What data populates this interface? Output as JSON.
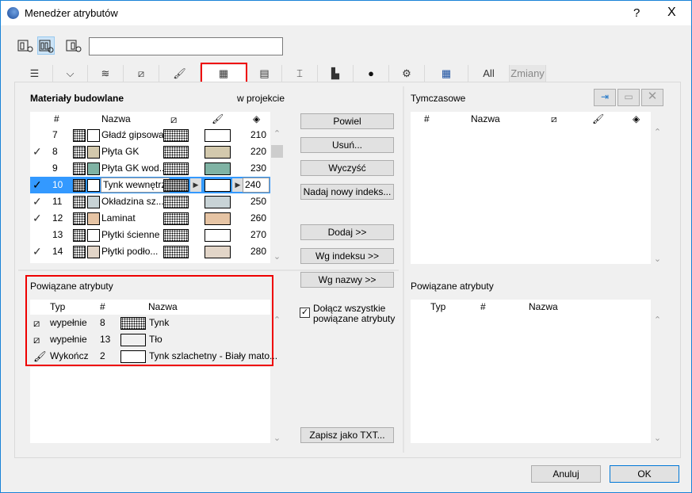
{
  "title": "Menedżer atrybutów",
  "title_help": "?",
  "title_close": "X",
  "search": {
    "value": "",
    "placeholder": ""
  },
  "tabs": [
    {
      "icon": "layers-icon"
    },
    {
      "icon": "pen-icon"
    },
    {
      "icon": "line-type-icon"
    },
    {
      "icon": "fill-icon"
    },
    {
      "icon": "surface-brush-icon"
    },
    {
      "icon": "building-material-icon",
      "selected": true
    },
    {
      "icon": "composite-icon"
    },
    {
      "icon": "profile-icon"
    },
    {
      "icon": "zone-icon"
    },
    {
      "icon": "globe-icon"
    },
    {
      "icon": "mep-icon"
    },
    {
      "icon": "table-icon"
    },
    {
      "label": "All"
    },
    {
      "label": "Zmiany"
    }
  ],
  "left": {
    "title": "Materiały budowlane",
    "subtitle": "w projekcie",
    "headers": {
      "num": "#",
      "name": "Nazwa"
    },
    "rows": [
      {
        "checked": false,
        "num": "7",
        "name": "Gładź gipsowa",
        "fill_color": "#ffffff",
        "surface_color": "#ffffff",
        "priority": "210"
      },
      {
        "checked": true,
        "num": "8",
        "name": "Płyta GK",
        "fill_color": "#d3c9ad",
        "surface_color": "#d3c9ad",
        "priority": "220"
      },
      {
        "checked": false,
        "num": "9",
        "name": "Płyta GK wod...",
        "fill_color": "#7fb3a4",
        "surface_color": "#7fb3a4",
        "priority": "230"
      },
      {
        "checked": true,
        "num": "10",
        "name": "Tynk wewnętrz",
        "fill_color": "#ffffff",
        "surface_color": "#ffffff",
        "priority": "240",
        "selected": true
      },
      {
        "checked": true,
        "num": "11",
        "name": "Okładzina sz...",
        "fill_color": "#c8d3d6",
        "surface_color": "#c8d3d6",
        "priority": "250"
      },
      {
        "checked": true,
        "num": "12",
        "name": "Laminat",
        "fill_color": "#e6c4a4",
        "surface_color": "#e6c4a4",
        "priority": "260"
      },
      {
        "checked": false,
        "num": "13",
        "name": "Płytki ścienne",
        "fill_color": "#ffffff",
        "surface_color": "#ffffff",
        "priority": "270"
      },
      {
        "checked": true,
        "num": "14",
        "name": "Płytki podło...",
        "fill_color": "#e2d5c8",
        "surface_color": "#e2d5c8",
        "priority": "280"
      }
    ],
    "related": {
      "title": "Powiązane atrybuty",
      "headers": {
        "type": "Typ",
        "num": "#",
        "name": "Nazwa"
      },
      "rows": [
        {
          "icon": "fill-icon",
          "type": "wypełnie",
          "num": "8",
          "name": "Tynk"
        },
        {
          "icon": "fill-icon",
          "type": "wypełnie",
          "num": "13",
          "name": "Tło"
        },
        {
          "icon": "surface-brush-icon",
          "type": "Wykończ",
          "num": "2",
          "name": "Tynk szlachetny - Biały mato..."
        }
      ]
    }
  },
  "middle": {
    "duplicate": "Powiel",
    "delete": "Usuń...",
    "clear": "Wyczyść",
    "reindex": "Nadaj nowy indeks...",
    "add": "Dodaj >>",
    "by_index": "Wg indeksu >>",
    "by_name": "Wg nazwy >>",
    "include_related": "Dołącz wszystkie powiązane atrybuty",
    "include_related_checked": true,
    "save_txt": "Zapisz jako TXT..."
  },
  "right": {
    "title": "Tymczasowe",
    "headers": {
      "num": "#",
      "name": "Nazwa"
    },
    "related": {
      "title": "Powiązane atrybuty",
      "headers": {
        "type": "Typ",
        "num": "#",
        "name": "Nazwa"
      }
    }
  },
  "footer": {
    "cancel": "Anuluj",
    "ok": "OK"
  }
}
